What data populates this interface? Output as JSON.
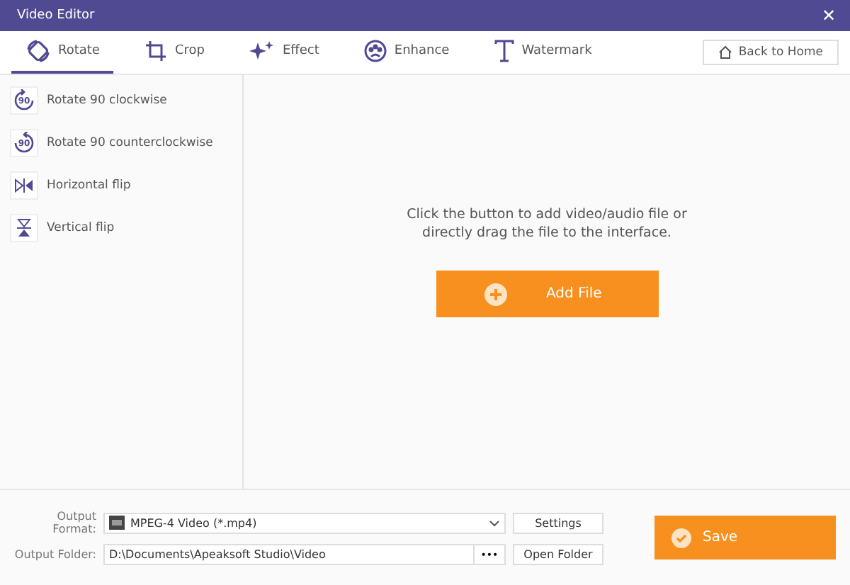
{
  "window": {
    "title": "Video Editor",
    "close": "✕"
  },
  "tabs": [
    {
      "label": "Rotate",
      "kind": "rotate",
      "selected": true
    },
    {
      "label": "Crop",
      "kind": "crop",
      "selected": false
    },
    {
      "label": "Effect",
      "kind": "effect",
      "selected": false
    },
    {
      "label": "Enhance",
      "kind": "enhance",
      "selected": false
    },
    {
      "label": "Watermark",
      "kind": "watermark",
      "selected": false
    }
  ],
  "back_button": "Back to Home",
  "sidebar": {
    "items": [
      {
        "label": "Rotate 90 clockwise",
        "kind": "cw",
        "badge": "90"
      },
      {
        "label": "Rotate 90 counterclockwise",
        "kind": "ccw",
        "badge": "90"
      },
      {
        "label": "Horizontal flip",
        "kind": "hflip"
      },
      {
        "label": "Vertical flip",
        "kind": "vflip"
      }
    ]
  },
  "main": {
    "hint": "Click the button to add video/audio file or directly drag the file to the interface.",
    "add_button": "Add File"
  },
  "footer": {
    "format_label": "Output Format:",
    "format_value": "MPEG-4 Video (*.mp4)",
    "settings_button": "Settings",
    "folder_label": "Output Folder:",
    "folder_value": "D:\\Documents\\Apeaksoft Studio\\Video",
    "browse_button": "•••",
    "open_folder_button": "Open Folder",
    "save_button": "Save"
  }
}
